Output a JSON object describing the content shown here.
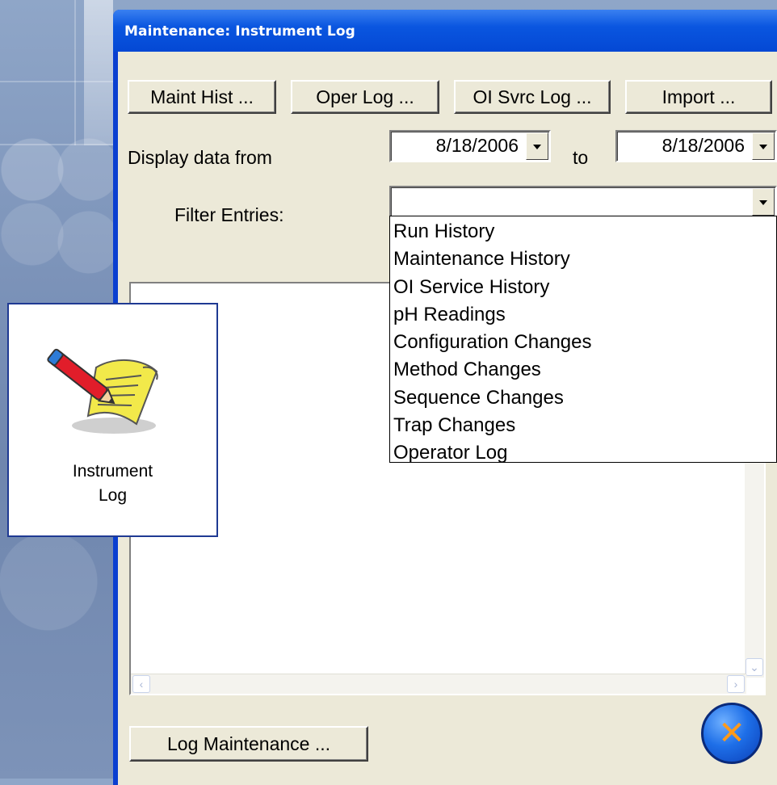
{
  "window": {
    "title": "Maintenance: Instrument Log"
  },
  "toolbar": {
    "maint_hist": "Maint Hist ...",
    "oper_log": "Oper Log ...",
    "oi_svc_log": "OI Svrc Log ...",
    "import": "Import ..."
  },
  "date_range": {
    "label": "Display data from",
    "from": "8/18/2006",
    "to_label": "to",
    "to": "8/18/2006"
  },
  "filter": {
    "label": "Filter Entries:",
    "value": "",
    "options": [
      "Run History",
      "Maintenance History",
      "OI Service History",
      "pH Readings",
      "Configuration Changes",
      "Method Changes",
      "Sequence Changes",
      "Trap Changes",
      "Operator Log"
    ]
  },
  "icon_card": {
    "label_line1": "Instrument",
    "label_line2": "Log"
  },
  "footer": {
    "log_maintenance": "Log Maintenance ..."
  },
  "close_button": {
    "glyph": "✕"
  },
  "colors": {
    "titlebar": "#0a56e0",
    "dialog_bg": "#ece9d8",
    "close_accent": "#ff9a1a"
  }
}
